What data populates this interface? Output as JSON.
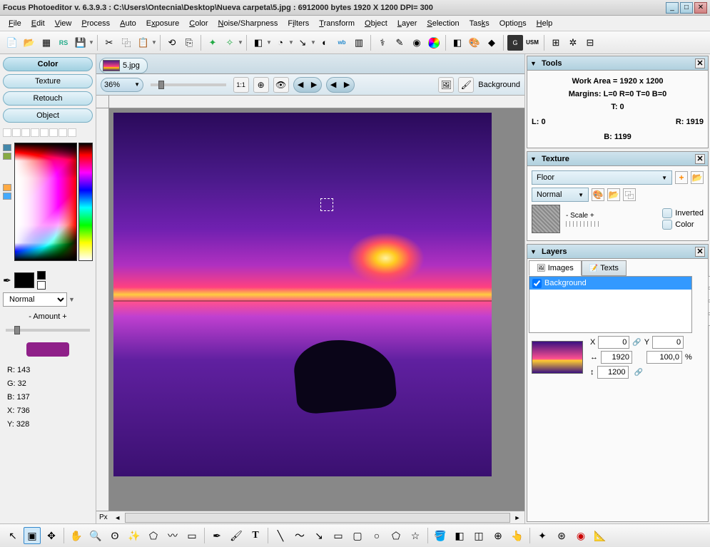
{
  "window": {
    "title": "Focus Photoeditor v. 6.3.9.3 :  C:\\Users\\Ontecnia\\Desktop\\Nueva carpeta\\5.jpg : 6912000 bytes       1920 X 1200 DPI= 300"
  },
  "menu": {
    "items": [
      "File",
      "Edit",
      "View",
      "Process",
      "Auto",
      "Exposure",
      "Color",
      "Noise/Sharpness",
      "Filters",
      "Transform",
      "Object",
      "Layer",
      "Selection",
      "Tasks",
      "Options",
      "Help"
    ]
  },
  "left": {
    "tabs": [
      "Color",
      "Texture",
      "Retouch",
      "Object"
    ],
    "blend_mode": "Normal",
    "amount_label": "- Amount +",
    "preview_color": "#8f2089",
    "info_r": "R: 143",
    "info_g": "G: 32",
    "info_b": "B: 137",
    "info_x": "X: 736",
    "info_y": "Y: 328"
  },
  "center": {
    "tab_filename": "5.jpg",
    "zoom": "36%",
    "layer_label": "Background",
    "px_label": "Px"
  },
  "right": {
    "tools": {
      "title": "Tools",
      "work_area": "Work Area = 1920 x 1200",
      "margins": "Margins: L=0 R=0 T=0 B=0",
      "t": "T: 0",
      "l": "L: 0",
      "r": "R: 1919",
      "b": "B: 1199"
    },
    "texture": {
      "title": "Texture",
      "type": "Floor",
      "blend": "Normal",
      "scale_label": "- Scale +",
      "inverted": "Inverted",
      "color": "Color"
    },
    "layers": {
      "title": "Layers",
      "tab_images": "Images",
      "tab_texts": "Texts",
      "bg_layer": "Background",
      "x_label": "X",
      "y_label": "Y",
      "x_val": "0",
      "y_val": "0",
      "w_val": "1920",
      "h_val": "1200",
      "opacity": "100,0",
      "pct": "%"
    }
  }
}
